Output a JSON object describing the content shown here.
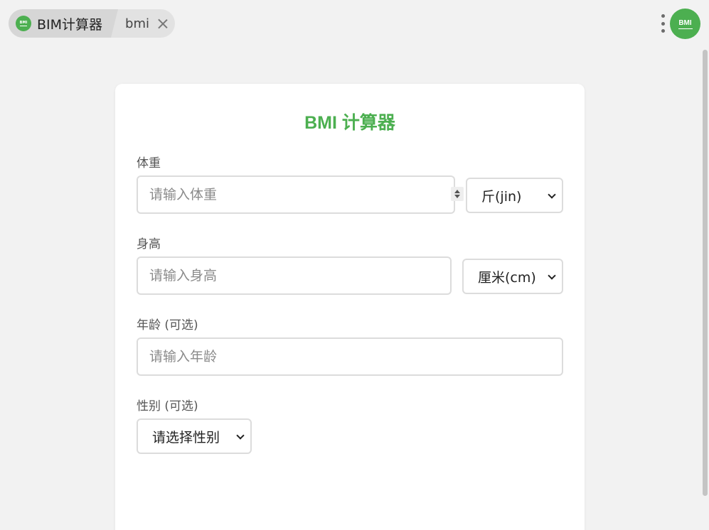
{
  "tabbar": {
    "app_logo_text": "BMI",
    "app_label": "BIM计算器",
    "page_label": "bmi",
    "avatar_text": "BMI"
  },
  "colors": {
    "accent": "#4caf50",
    "background": "#f2f2f2",
    "card": "#ffffff",
    "border": "#dcdcdc"
  },
  "form": {
    "title": "BMI 计算器",
    "weight": {
      "label": "体重",
      "placeholder": "请输入体重",
      "unit_selected": "斤(jin)"
    },
    "height": {
      "label": "身高",
      "placeholder": "请输入身高",
      "unit_selected": "厘米(cm)"
    },
    "age": {
      "label": "年龄 (可选)",
      "placeholder": "请输入年龄"
    },
    "gender": {
      "label": "性别 (可选)",
      "selected": "请选择性别"
    }
  },
  "icons": {
    "close": "close-icon",
    "more": "more-vertical-icon",
    "chevron": "chevron-down-icon",
    "spinner": "number-spinner-icon"
  }
}
